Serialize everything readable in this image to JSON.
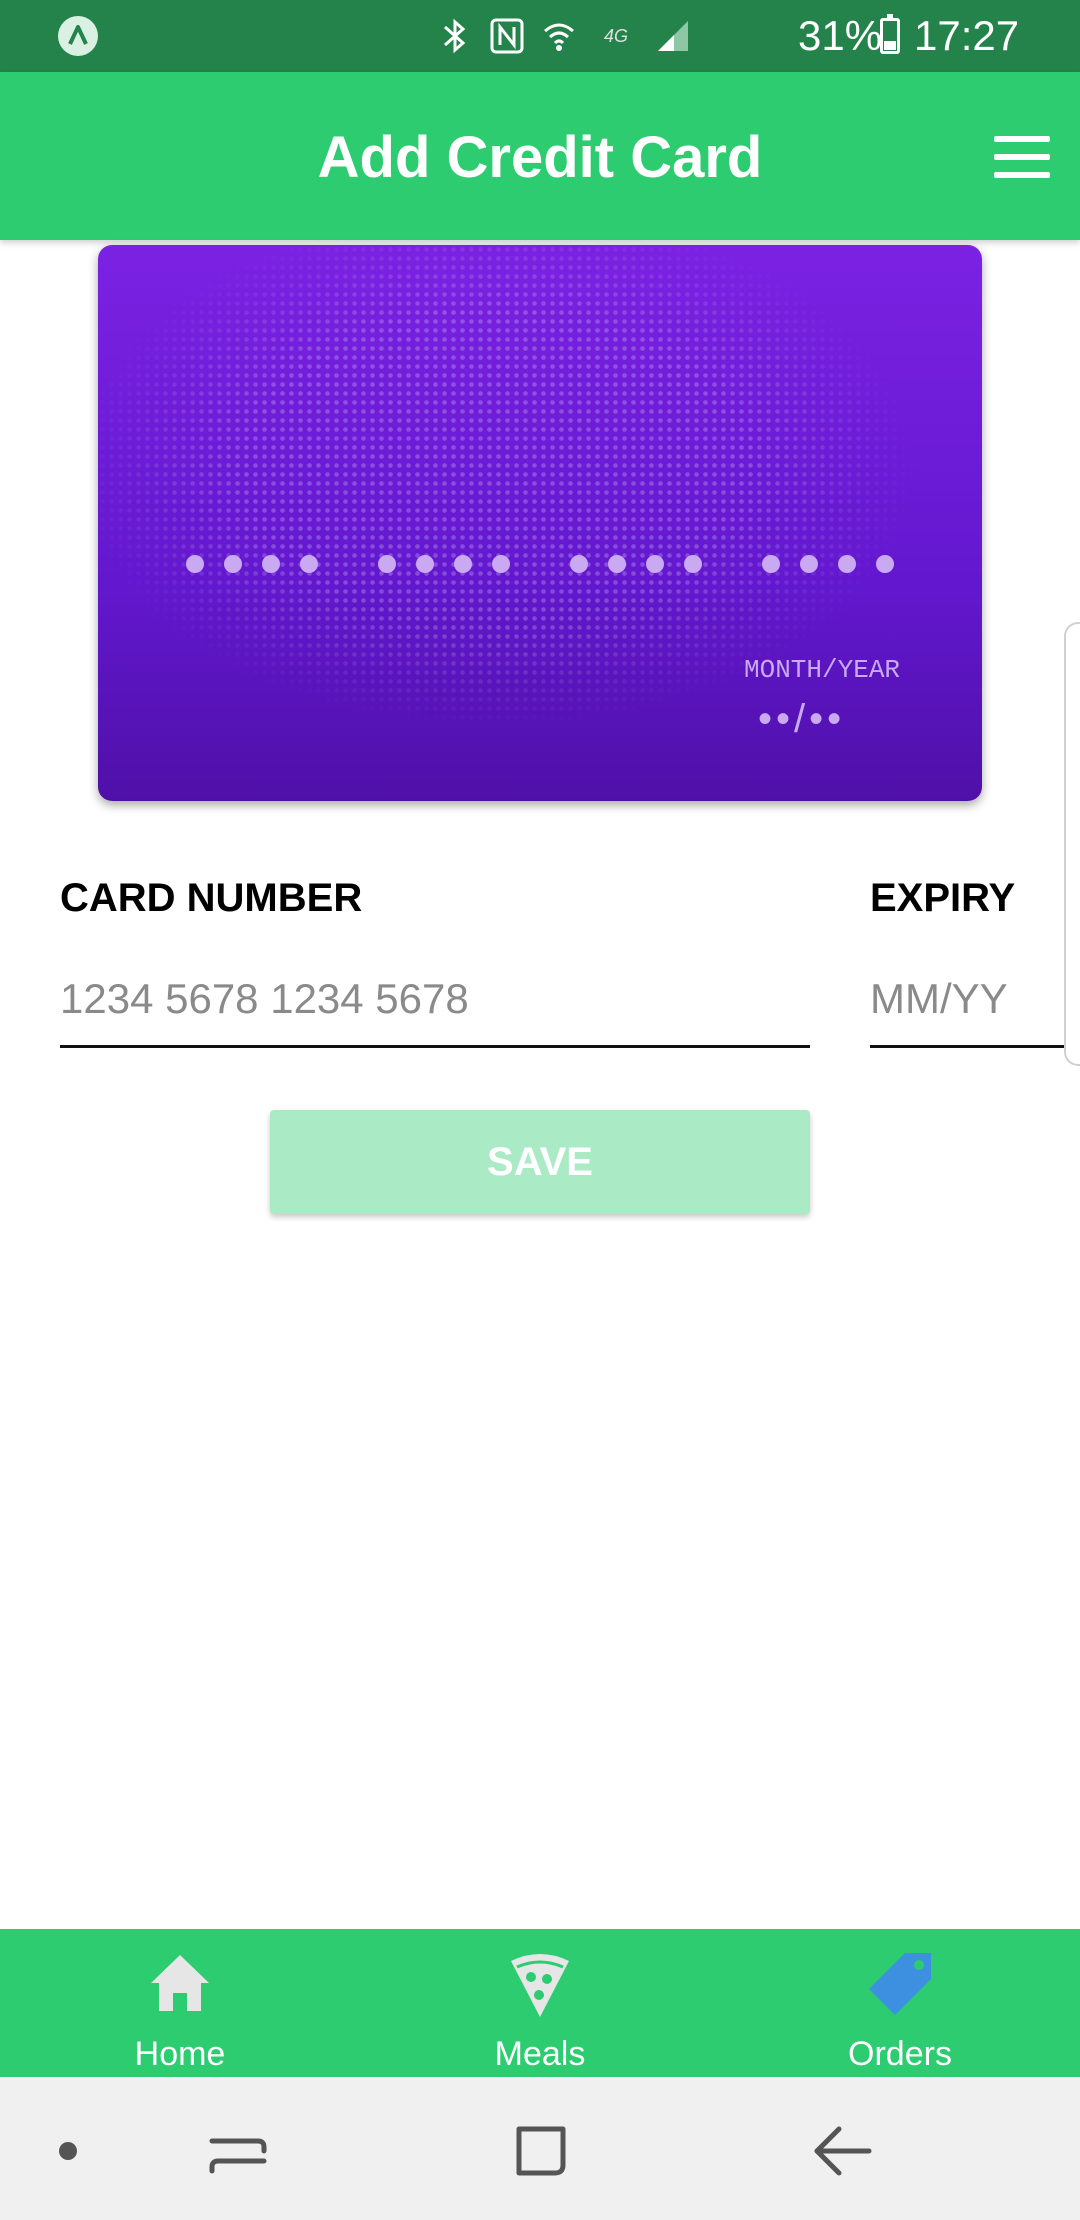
{
  "status_bar": {
    "battery": "31%",
    "time": "17:27",
    "network": "4G",
    "icons": [
      "app-notification-icon",
      "bluetooth-icon",
      "nfc-icon",
      "wifi-icon",
      "signal-icon",
      "battery-icon"
    ]
  },
  "header": {
    "title": "Add Credit Card",
    "menu_icon": "hamburger-menu-icon"
  },
  "card": {
    "number_mask": [
      "••••",
      "••••",
      "••••",
      "••••"
    ],
    "expiry_label": "MONTH/YEAR",
    "expiry_mask": "••/••",
    "background_color": "#6a1bd6"
  },
  "form": {
    "card_number_label": "CARD NUMBER",
    "card_number_placeholder": "1234 5678 1234 5678",
    "expiry_label": "EXPIRY",
    "expiry_placeholder": "MM/YY",
    "save_label": "SAVE"
  },
  "tabs": [
    {
      "label": "Home",
      "icon": "home-icon",
      "active": false
    },
    {
      "label": "Meals",
      "icon": "pizza-icon",
      "active": false
    },
    {
      "label": "Orders",
      "icon": "tag-icon",
      "active": true
    }
  ],
  "colors": {
    "primary": "#2ecc71",
    "status_bar": "#24834a",
    "save_disabled": "#aaebc6",
    "active_tab_icon": "#3d8fdf",
    "inactive_tab_icon": "#e6e6e6"
  },
  "nav_bar": {
    "icons": [
      "nav-dot-icon",
      "recents-icon",
      "home-square-icon",
      "back-icon"
    ]
  }
}
